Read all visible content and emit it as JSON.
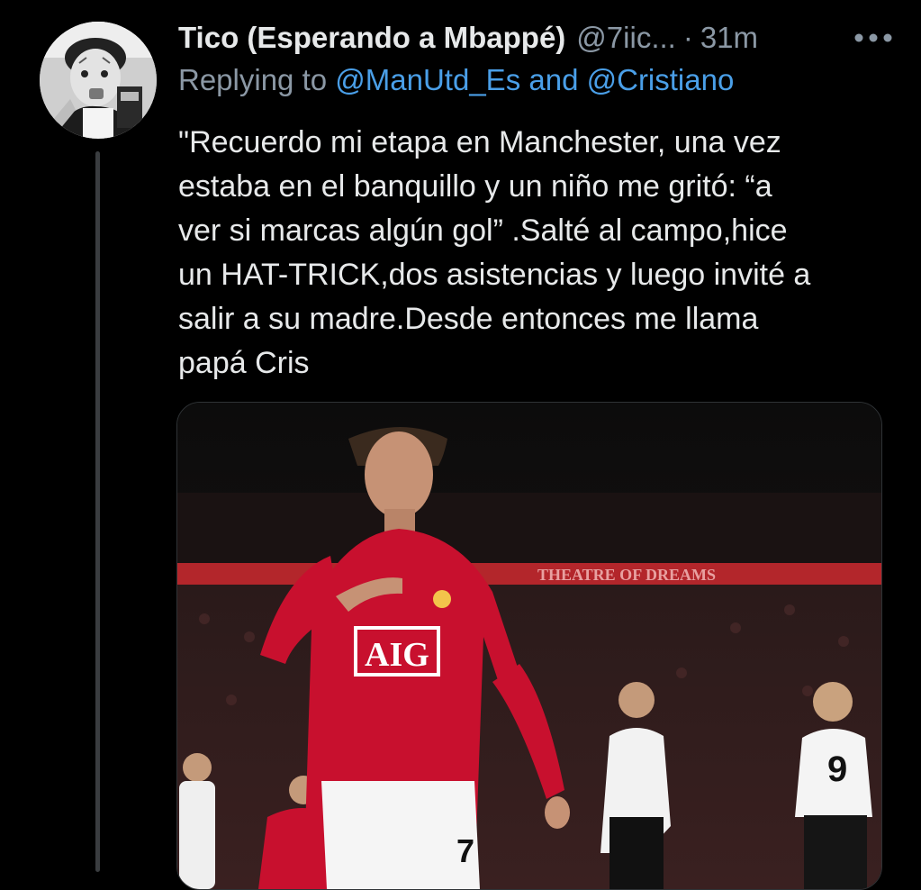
{
  "tweet": {
    "author": {
      "display_name": "Tico (Esperando a Mbappé)",
      "handle": "@7iic...",
      "separator": "·",
      "time": "31m"
    },
    "more_icon": "more-horizontal-icon",
    "reply": {
      "prefix": "Replying to",
      "mention_1": "@ManUtd_Es",
      "conjunction": "and",
      "mention_2": "@Cristiano"
    },
    "text_lines": [
      "\"Recuerdo mi etapa en Manchester, una vez",
      "estaba en el banquillo y un niño me gritó: “a",
      "ver si marcas algún gol” .Salté al campo,hice",
      "un HAT-TRICK,dos asistencias y luego invité a",
      "salir a su madre.Desde entonces me llama",
      "papá Cris"
    ],
    "media": {
      "stand_banner": "THEATRE OF DREAMS",
      "shirt_sponsor": "AIG",
      "shirt_number": "7",
      "opponent_number": "9"
    }
  },
  "colors": {
    "background": "#000000",
    "primary_text": "#e7e9ea",
    "secondary_text": "#8b98a5",
    "link": "#4a9fe8",
    "thread_line": "#3a3d40",
    "united_red": "#c8102e"
  }
}
